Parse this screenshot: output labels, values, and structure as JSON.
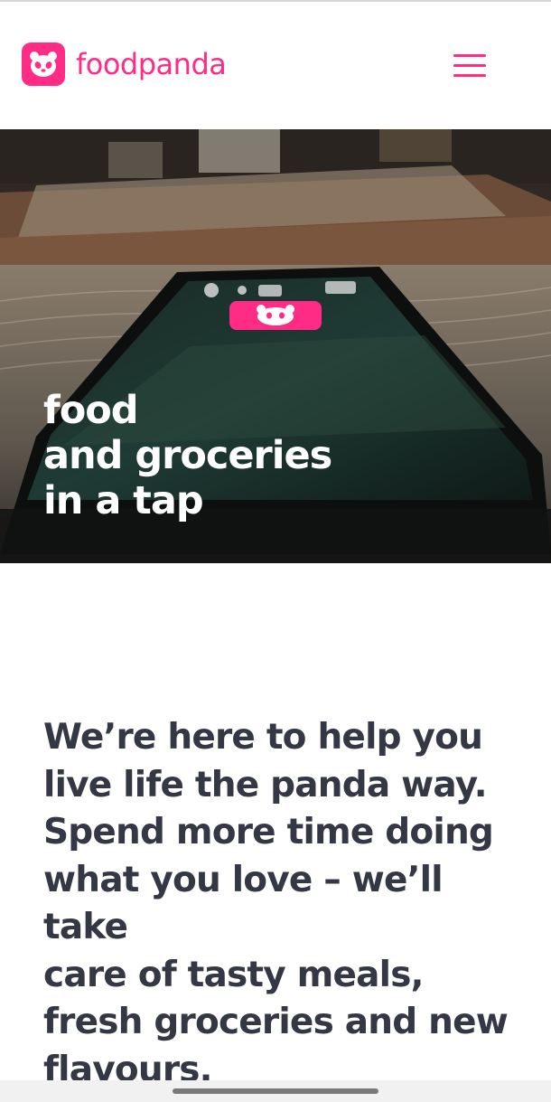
{
  "header": {
    "brand_name": "foodpanda",
    "logo_icon": "panda-face-icon",
    "menu_icon": "hamburger-menu-icon"
  },
  "hero": {
    "headline_lines": [
      "food",
      "and groceries",
      "in a tap"
    ],
    "phone_app_icon": "foodpanda-app-icon"
  },
  "intro": {
    "text": "We’re here to help you\nlive life the panda way.\nSpend more time doing\nwhat you love – we’ll\ntake\ncare of tasty meals,\nfresh groceries and new\nflavours."
  },
  "colors": {
    "brand_pink": "#ff2b85",
    "body_text": "#333844",
    "header_bg": "#ffffff"
  }
}
